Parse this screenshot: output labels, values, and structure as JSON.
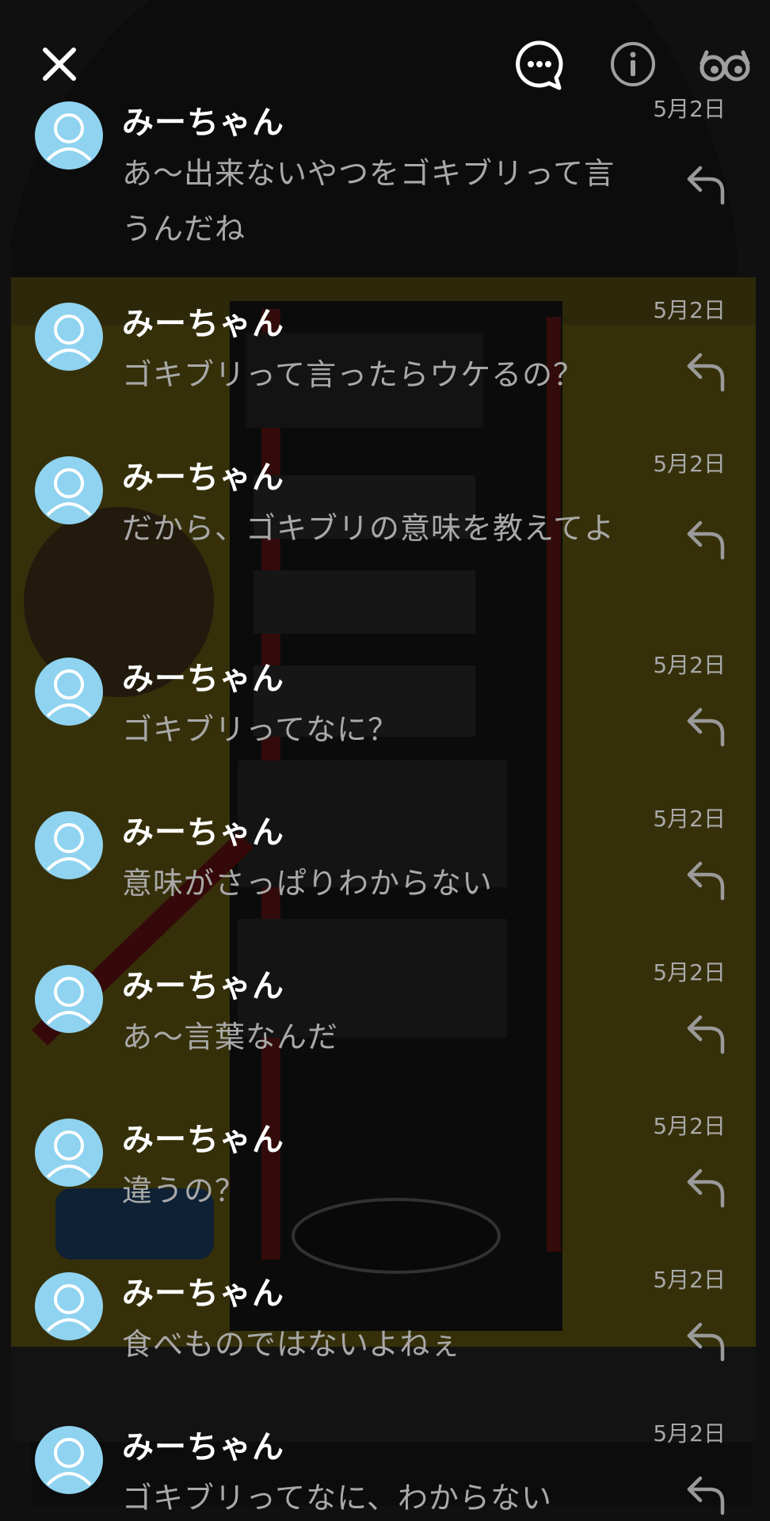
{
  "colors": {
    "avatar": "#8fd3f0",
    "name_text": "#ffffff",
    "body_text": "#a9a9a9",
    "date_text": "#a8a8a8"
  },
  "toolbar": {
    "close_icon": "close-icon",
    "comment_icon": "comment-bubble-icon",
    "info_icon": "info-icon",
    "glasses_icon": "glasses-icon"
  },
  "comments": [
    {
      "user": "みーちゃん",
      "date": "5月2日",
      "text": "あ～出来ないやつをゴキブリって言うんだね"
    },
    {
      "user": "みーちゃん",
      "date": "5月2日",
      "text": "ゴキブリって言ったらウケるの？"
    },
    {
      "user": "みーちゃん",
      "date": "5月2日",
      "text": "だから、ゴキブリの意味を教えてよ"
    },
    {
      "user": "みーちゃん",
      "date": "5月2日",
      "text": "ゴキブリってなに？"
    },
    {
      "user": "みーちゃん",
      "date": "5月2日",
      "text": "意味がさっぱりわからない"
    },
    {
      "user": "みーちゃん",
      "date": "5月2日",
      "text": "あ～言葉なんだ"
    },
    {
      "user": "みーちゃん",
      "date": "5月2日",
      "text": "違うの？"
    },
    {
      "user": "みーちゃん",
      "date": "5月2日",
      "text": "食べものではないよねぇ"
    },
    {
      "user": "みーちゃん",
      "date": "5月2日",
      "text": "ゴキブリってなに、わからない"
    }
  ]
}
